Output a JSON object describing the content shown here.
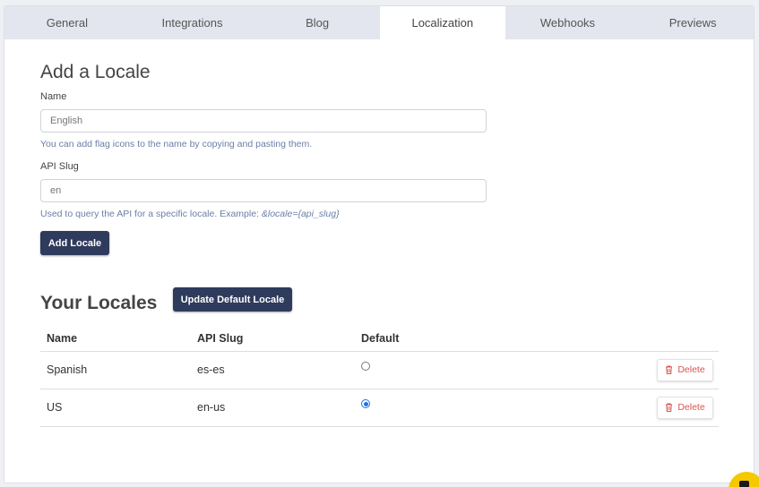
{
  "tabs": [
    {
      "label": "General",
      "active": false
    },
    {
      "label": "Integrations",
      "active": false
    },
    {
      "label": "Blog",
      "active": false
    },
    {
      "label": "Localization",
      "active": true
    },
    {
      "label": "Webhooks",
      "active": false
    },
    {
      "label": "Previews",
      "active": false
    }
  ],
  "add_locale": {
    "title": "Add a Locale",
    "name_label": "Name",
    "name_placeholder": "English",
    "name_help_prefix": "You can add flag icons to the name by ",
    "name_help_link": "copying and pasting them.",
    "slug_label": "API Slug",
    "slug_placeholder": "en",
    "slug_help_prefix": "Used to query the API for a specific locale. Example: ",
    "slug_help_example": "&locale={api_slug}",
    "submit_label": "Add Locale"
  },
  "your_locales": {
    "title": "Your Locales",
    "update_default_label": "Update Default Locale",
    "columns": [
      "Name",
      "API Slug",
      "Default"
    ],
    "rows": [
      {
        "name": "Spanish",
        "slug": "es-es",
        "default": false,
        "delete_label": "Delete"
      },
      {
        "name": "US",
        "slug": "en-us",
        "default": true,
        "delete_label": "Delete"
      }
    ]
  },
  "colors": {
    "accent": "#2f3b5c",
    "danger": "#d9534f",
    "help_text": "#6a7fa8",
    "radio_selected": "#1a73e8",
    "chat_widget": "#f5c800"
  },
  "icons": {
    "delete": "trash-icon",
    "chat": "chat-icon"
  }
}
